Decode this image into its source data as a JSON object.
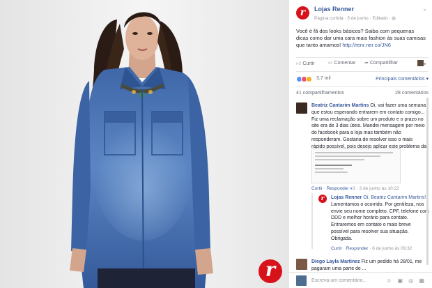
{
  "photo": {
    "logo_letter": "r"
  },
  "post": {
    "page_name": "Lojas Renner",
    "meta": "Página curtida · 5 de junho · Editado ·",
    "globe_icon": "globe-icon",
    "text": "Você é fã dos looks básicos? Saiba com pequenas dicas como dar uma cara mais fashion às suas camisas que tanto amamos!",
    "link": "http://renr.ner.co/JN6"
  },
  "actions": {
    "like": "Curtir",
    "comment": "Comentar",
    "share": "Compartilhar"
  },
  "reactions": {
    "count": "3,7 mil",
    "relevant": "Principais comentários ▾",
    "colors": [
      "#5890ff",
      "#f25268",
      "#f7b125"
    ]
  },
  "stats": {
    "shares": "41 compartilhamentos",
    "comments": "28 comentários"
  },
  "comments": [
    {
      "author": "Beatriz Cantarim Martins",
      "text": "Oi, vai fazer uma semana que estou esperando entrarem em contato comigo... Fiz uma reclamação sobre um produto e o prazo no site era de 3 dias úteis. Mandei mensagem por meio do facebook para a loja mas também não responderam. Gostaria de resolver isso o mais rápido possível, pois desejo aplicar este problema da Renner!",
      "meta_like": "Curtir",
      "meta_reply": "Responder",
      "meta_count": "3",
      "meta_date": "3 de junho às 10:22",
      "avatar_color": "#3a2a22"
    },
    {
      "author": "Lojas Renner",
      "mention": "Oi, Beatriz Cantarim Martins!",
      "text": "Lamentamos o ocorrido. Por gentileza, nos envie seu nome completo, CPF, telefone com DDD e melhor horário para contato. Entraremos em contato o mais breve possível para resolver sua situação. Obrigada.",
      "meta_like": "Curtir",
      "meta_reply": "Responder",
      "meta_date": "6 de junho às 09:32"
    },
    {
      "author": "Diego Layla Martinez",
      "text": "Fiz um pedido há 28/01, me pagaram uma parte de ...",
      "avatar_color": "#7a5a46"
    }
  ],
  "compose": {
    "placeholder": "Escreva um comentário...",
    "icons": "☺ ▣ ◎ ▦"
  }
}
